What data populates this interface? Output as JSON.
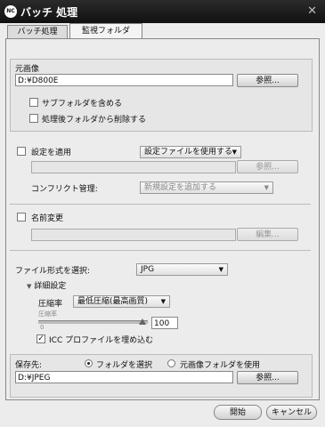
{
  "window": {
    "title": "バッチ 処理",
    "logo": "NC"
  },
  "tabs": [
    {
      "label": "バッチ処理",
      "active": false
    },
    {
      "label": "監視フォルダ",
      "active": true
    }
  ],
  "source": {
    "label": "元画像",
    "path": "D:¥D800E",
    "browse": "参照...",
    "include_subfolders": "サブフォルダを含める",
    "include_subfolders_checked": false,
    "delete_after": "処理後フォルダから削除する",
    "delete_after_checked": false
  },
  "settings": {
    "label": "設定を適用",
    "checked": false,
    "mode": "設定ファイルを使用する",
    "browse": "参照...",
    "conflict_label": "コンフリクト管理:",
    "conflict_value": "新規設定を追加する"
  },
  "rename": {
    "label": "名前変更",
    "checked": false,
    "edit": "編集..."
  },
  "format": {
    "label": "ファイル形式を選択:",
    "value": "JPG",
    "details_label": "詳細設定",
    "compression_label": "圧縮率",
    "compression_value": "最低圧縮(最高画質)",
    "slider_label": "圧縮率",
    "slider_min": "0",
    "quality": "100",
    "icc_label": "ICC プロファイルを埋め込む",
    "icc_checked": true
  },
  "destination": {
    "label": "保存先:",
    "option_select": "フォルダを選択",
    "option_source": "元画像フォルダを使用",
    "selected": "select",
    "path": "D:¥JPEG",
    "browse": "参照..."
  },
  "footer": {
    "start": "開始",
    "cancel": "キャンセル"
  }
}
